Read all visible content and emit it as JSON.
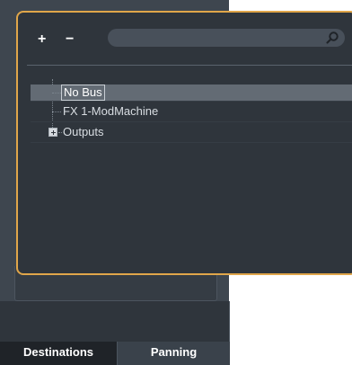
{
  "toolbar": {
    "add_label": "+",
    "remove_label": "−"
  },
  "search": {
    "placeholder": ""
  },
  "tree": {
    "items": [
      {
        "label": "No Bus",
        "selected": true,
        "expandable": false
      },
      {
        "label": "FX 1-ModMachine",
        "selected": false,
        "expandable": false
      },
      {
        "label": "Outputs",
        "selected": false,
        "expandable": true
      }
    ]
  },
  "tabs": [
    {
      "label": "Destinations",
      "active": true
    },
    {
      "label": "Panning",
      "active": false
    }
  ],
  "colors": {
    "accent_border": "#e0a64a",
    "popup_bg": "#2f353c",
    "selection_bg": "#636b74"
  },
  "icons": {
    "search": "search-icon",
    "expand": "plus-square-icon"
  }
}
